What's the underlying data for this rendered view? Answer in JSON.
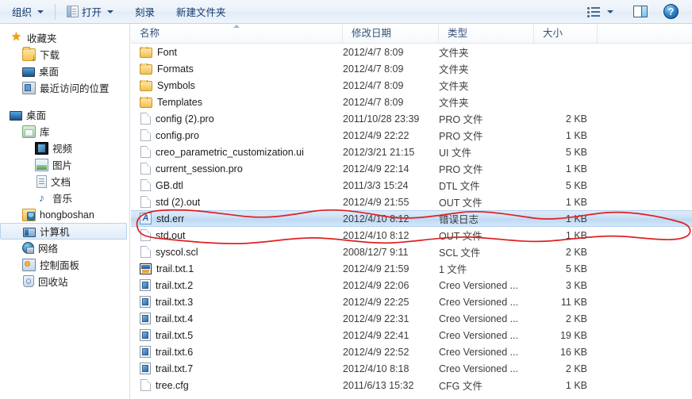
{
  "toolbar": {
    "organize_label": "组织",
    "open_label": "打开",
    "burn_label": "刻录",
    "new_folder_label": "新建文件夹",
    "views_icon": "views-icon",
    "views_caret_icon": "chevron-down-icon",
    "preview_pane_icon": "preview-pane-icon",
    "help_icon": "help-icon",
    "help_glyph": "?"
  },
  "sidebar": {
    "groups": [
      {
        "items": [
          {
            "label": "收藏夹",
            "icon": "star-icon",
            "indent": 0,
            "selected": false
          },
          {
            "label": "下载",
            "icon": "download-folder-icon",
            "indent": 1,
            "selected": false
          },
          {
            "label": "桌面",
            "icon": "desktop-monitor-icon",
            "indent": 1,
            "selected": false
          },
          {
            "label": "最近访问的位置",
            "icon": "recent-places-icon",
            "indent": 1,
            "selected": false
          }
        ]
      },
      {
        "items": [
          {
            "label": "桌面",
            "icon": "desktop-monitor-icon",
            "indent": 0,
            "selected": false
          },
          {
            "label": "库",
            "icon": "library-icon",
            "indent": 1,
            "selected": false
          },
          {
            "label": "视频",
            "icon": "video-icon",
            "indent": 2,
            "selected": false
          },
          {
            "label": "图片",
            "icon": "pictures-icon",
            "indent": 2,
            "selected": false
          },
          {
            "label": "文档",
            "icon": "documents-icon",
            "indent": 2,
            "selected": false
          },
          {
            "label": "音乐",
            "icon": "music-icon",
            "indent": 2,
            "selected": false
          },
          {
            "label": "hongboshan",
            "icon": "user-folder-icon",
            "indent": 1,
            "selected": false
          },
          {
            "label": "计算机",
            "icon": "computer-icon",
            "indent": 1,
            "selected": true
          },
          {
            "label": "网络",
            "icon": "network-icon",
            "indent": 1,
            "selected": false
          },
          {
            "label": "控制面板",
            "icon": "control-panel-icon",
            "indent": 1,
            "selected": false
          },
          {
            "label": "回收站",
            "icon": "recycle-bin-icon",
            "indent": 1,
            "selected": false
          }
        ]
      }
    ]
  },
  "file_list": {
    "columns": {
      "name": "名称",
      "date_modified": "修改日期",
      "type": "类型",
      "size": "大小"
    },
    "sort_column": "名称",
    "sort_direction": "ascending",
    "rows": [
      {
        "name": "Font",
        "date": "2012/4/7 8:09",
        "type": "文件夹",
        "size": "",
        "icon": "folder-icon",
        "selected": false
      },
      {
        "name": "Formats",
        "date": "2012/4/7 8:09",
        "type": "文件夹",
        "size": "",
        "icon": "folder-icon",
        "selected": false
      },
      {
        "name": "Symbols",
        "date": "2012/4/7 8:09",
        "type": "文件夹",
        "size": "",
        "icon": "folder-icon",
        "selected": false
      },
      {
        "name": "Templates",
        "date": "2012/4/7 8:09",
        "type": "文件夹",
        "size": "",
        "icon": "folder-icon",
        "selected": false
      },
      {
        "name": "config (2).pro",
        "date": "2011/10/28 23:39",
        "type": "PRO 文件",
        "size": "2 KB",
        "icon": "generic-file-icon",
        "selected": false
      },
      {
        "name": "config.pro",
        "date": "2012/4/9 22:22",
        "type": "PRO 文件",
        "size": "1 KB",
        "icon": "generic-file-icon",
        "selected": false
      },
      {
        "name": "creo_parametric_customization.ui",
        "date": "2012/3/21 21:15",
        "type": "UI 文件",
        "size": "5 KB",
        "icon": "generic-file-icon",
        "selected": false
      },
      {
        "name": "current_session.pro",
        "date": "2012/4/9 22:14",
        "type": "PRO 文件",
        "size": "1 KB",
        "icon": "generic-file-icon",
        "selected": false
      },
      {
        "name": "GB.dtl",
        "date": "2011/3/3 15:24",
        "type": "DTL 文件",
        "size": "5 KB",
        "icon": "generic-file-icon",
        "selected": false
      },
      {
        "name": "std (2).out",
        "date": "2012/4/9 21:55",
        "type": "OUT 文件",
        "size": "1 KB",
        "icon": "generic-file-icon",
        "selected": false
      },
      {
        "name": "std.err",
        "date": "2012/4/10 8:12",
        "type": "错误日志",
        "size": "1 KB",
        "icon": "error-log-a-icon",
        "selected": true
      },
      {
        "name": "std.out",
        "date": "2012/4/10 8:12",
        "type": "OUT 文件",
        "size": "1 KB",
        "icon": "generic-file-icon",
        "selected": false
      },
      {
        "name": "syscol.scl",
        "date": "2008/12/7 9:11",
        "type": "SCL 文件",
        "size": "2 KB",
        "icon": "generic-file-icon",
        "selected": false
      },
      {
        "name": "trail.txt.1",
        "date": "2012/4/9 21:59",
        "type": "1 文件",
        "size": "5 KB",
        "icon": "trail-file-icon",
        "selected": false
      },
      {
        "name": "trail.txt.2",
        "date": "2012/4/9 22:06",
        "type": "Creo Versioned ...",
        "size": "3 KB",
        "icon": "creo-versioned-icon",
        "selected": false
      },
      {
        "name": "trail.txt.3",
        "date": "2012/4/9 22:25",
        "type": "Creo Versioned ...",
        "size": "11 KB",
        "icon": "creo-versioned-icon",
        "selected": false
      },
      {
        "name": "trail.txt.4",
        "date": "2012/4/9 22:31",
        "type": "Creo Versioned ...",
        "size": "2 KB",
        "icon": "creo-versioned-icon",
        "selected": false
      },
      {
        "name": "trail.txt.5",
        "date": "2012/4/9 22:41",
        "type": "Creo Versioned ...",
        "size": "19 KB",
        "icon": "creo-versioned-icon",
        "selected": false
      },
      {
        "name": "trail.txt.6",
        "date": "2012/4/9 22:52",
        "type": "Creo Versioned ...",
        "size": "16 KB",
        "icon": "creo-versioned-icon",
        "selected": false
      },
      {
        "name": "trail.txt.7",
        "date": "2012/4/10 8:18",
        "type": "Creo Versioned ...",
        "size": "2 KB",
        "icon": "creo-versioned-icon",
        "selected": false
      },
      {
        "name": "tree.cfg",
        "date": "2011/6/13 15:32",
        "type": "CFG 文件",
        "size": "1 KB",
        "icon": "generic-file-icon",
        "selected": false
      }
    ]
  },
  "annotation": {
    "color": "#e02020",
    "shape": "hand-drawn-ellipse",
    "target": "std.err"
  }
}
